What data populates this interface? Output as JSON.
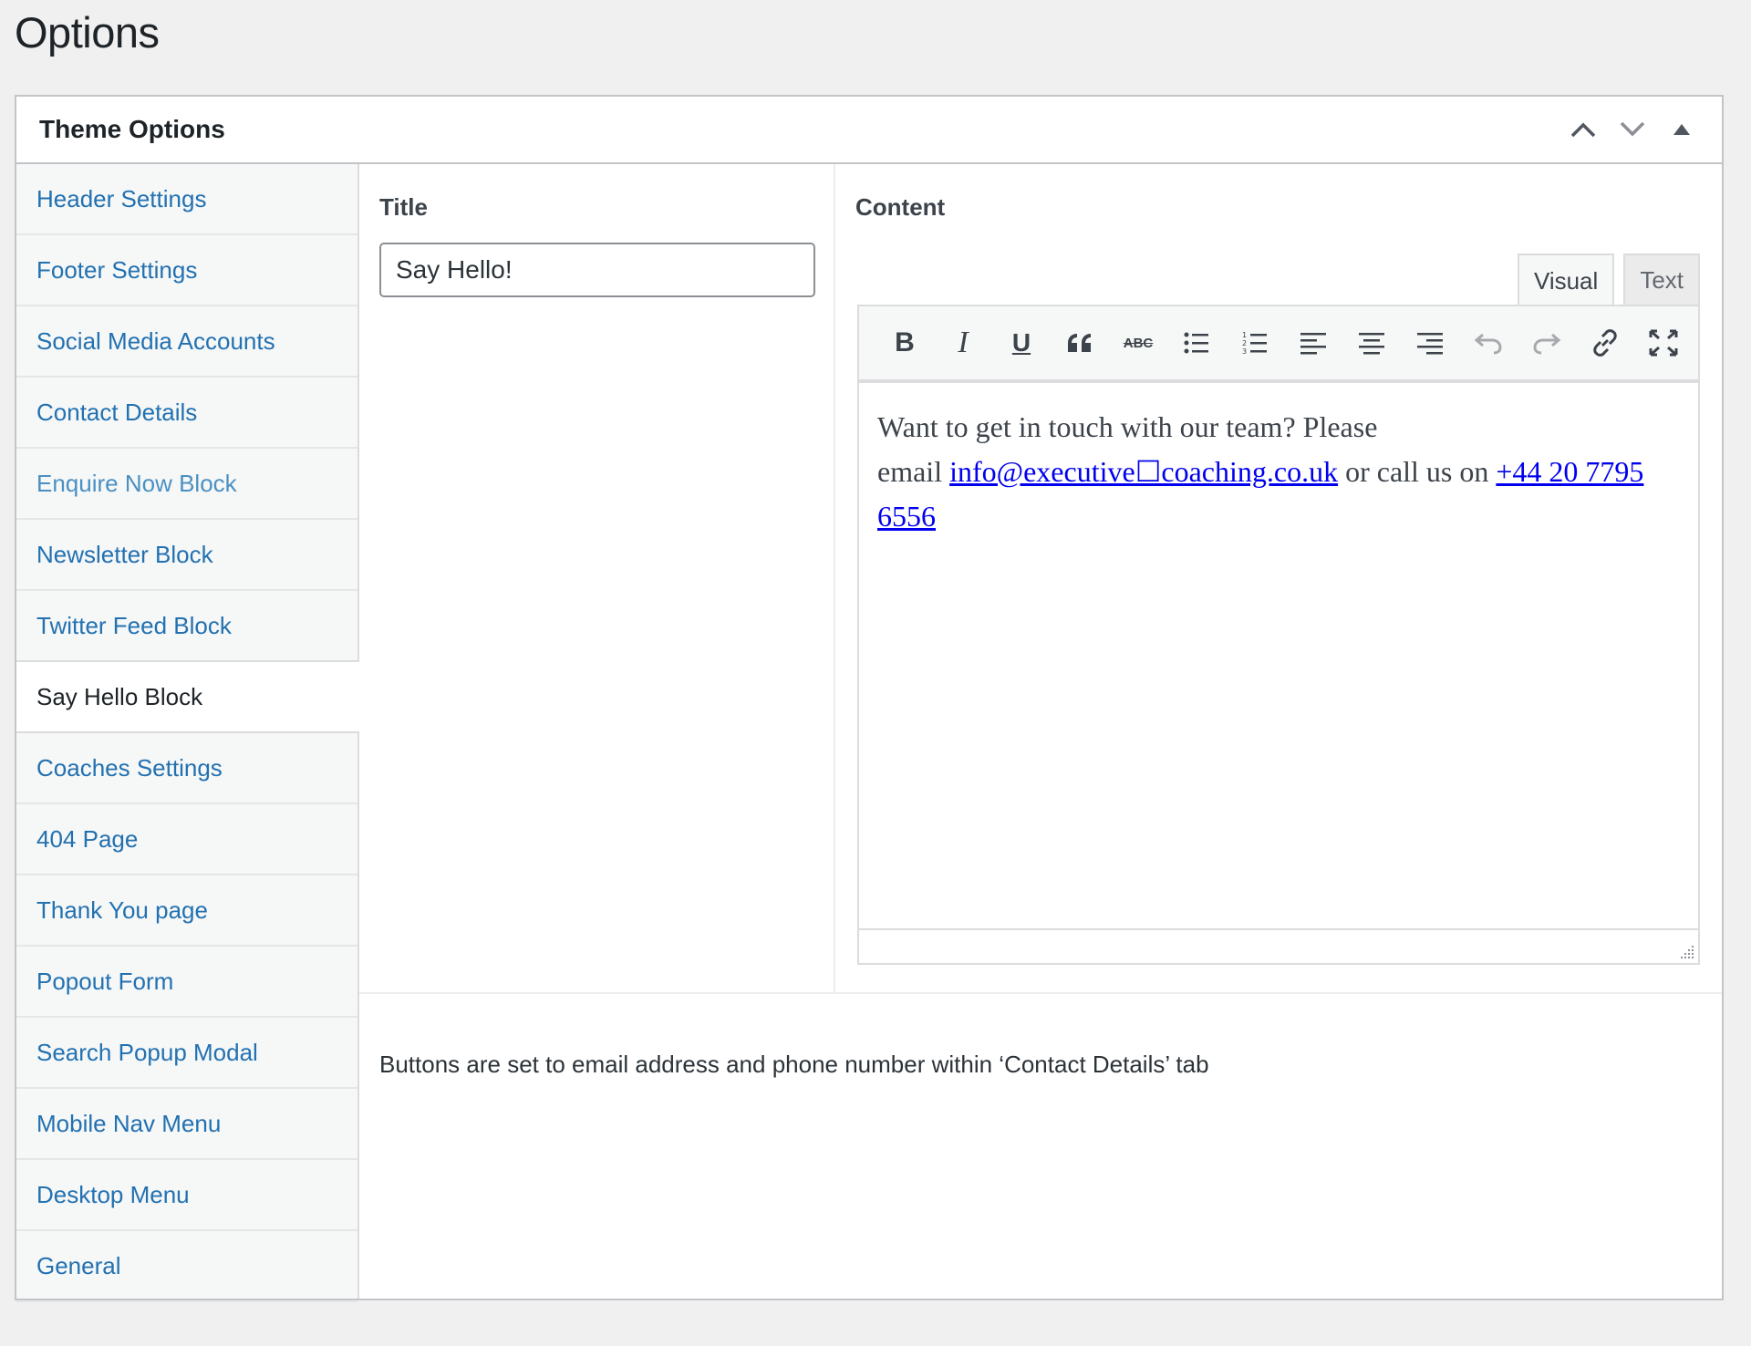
{
  "page": {
    "title": "Options"
  },
  "postbox": {
    "title": "Theme Options",
    "controls": [
      "chevron-up-icon",
      "chevron-down-icon",
      "triangle-up-icon"
    ]
  },
  "sidebar": {
    "items": [
      {
        "label": "Header Settings"
      },
      {
        "label": "Footer Settings"
      },
      {
        "label": "Social Media Accounts"
      },
      {
        "label": "Contact Details"
      },
      {
        "label": "Enquire Now Block"
      },
      {
        "label": "Newsletter Block"
      },
      {
        "label": "Twitter Feed Block"
      },
      {
        "label": "Say Hello Block"
      },
      {
        "label": "Coaches Settings"
      },
      {
        "label": "404 Page"
      },
      {
        "label": "Thank You page"
      },
      {
        "label": "Popout Form"
      },
      {
        "label": "Search Popup Modal"
      },
      {
        "label": "Mobile Nav Menu"
      },
      {
        "label": "Desktop Menu"
      },
      {
        "label": "General"
      }
    ],
    "active_index": 7
  },
  "title_field": {
    "label": "Title",
    "value": "Say Hello!"
  },
  "content_field": {
    "label": "Content",
    "tabs": {
      "visual": "Visual",
      "text": "Text"
    },
    "toolbar": [
      "bold-icon",
      "italic-icon",
      "underline-icon",
      "blockquote-icon",
      "strikethrough-icon",
      "bullet-list-icon",
      "numbered-list-icon",
      "align-left-icon",
      "align-center-icon",
      "align-right-icon",
      "undo-icon",
      "redo-icon",
      "link-icon",
      "fullscreen-icon"
    ],
    "toolbar_labels": {
      "bold": "B",
      "italic": "I",
      "underline": "U",
      "strike": "ABC"
    },
    "body": {
      "line1": "Want to get in touch with our team? Please",
      "prefix": "email ",
      "email": "info@executive☐coaching.co.uk",
      "middle": " or call us on ",
      "phone": "+44 20 7795 6556"
    }
  },
  "footer_note": "Buttons are set to email address and phone number within ‘Contact Details’ tab"
}
